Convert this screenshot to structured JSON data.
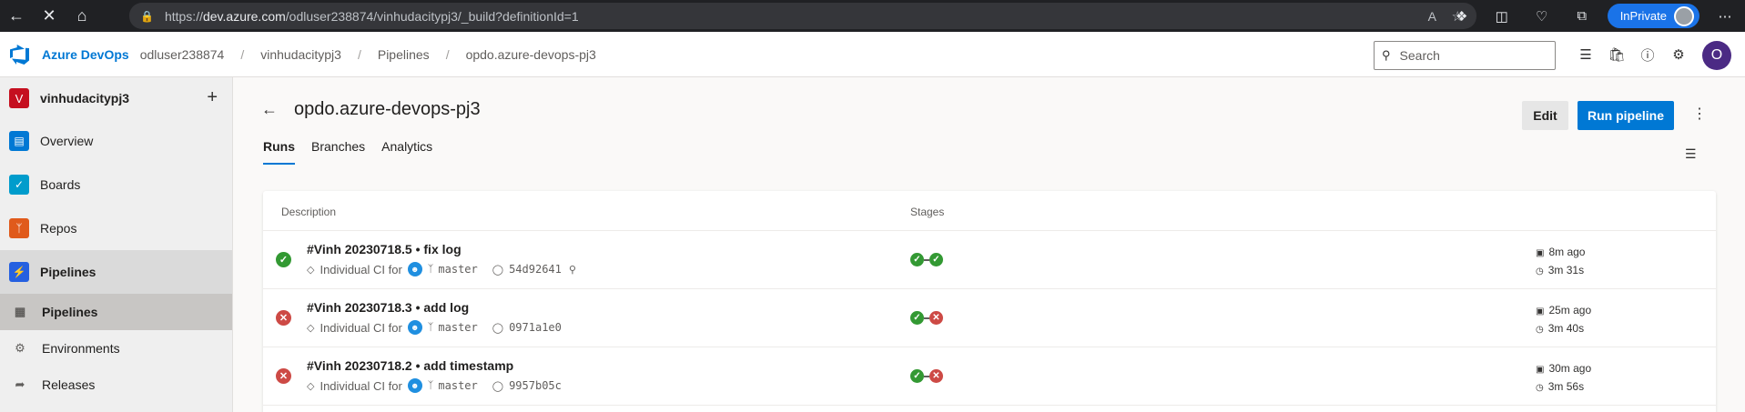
{
  "browser": {
    "url_prefix": "https://",
    "url_host": "dev.azure.com",
    "url_path": "/odluser238874/vinhudacitypj3/_build?definitionId=1",
    "inprivate_label": "InPrivate",
    "read_aloud_label": "A"
  },
  "header": {
    "brand": "Azure DevOps",
    "breadcrumbs": [
      "odluser238874",
      "vinhudacitypj3",
      "Pipelines",
      "opdo.azure-devops-pj3"
    ],
    "separator": "/",
    "search_placeholder": "Search",
    "user_initial": "O"
  },
  "sidebar": {
    "project_initial": "V",
    "project_name": "vinhudacitypj3",
    "add_label": "+",
    "items": [
      {
        "label": "Overview",
        "icon": "overview-icon",
        "color": "#0078d4"
      },
      {
        "label": "Boards",
        "icon": "boards-icon",
        "color": "#009ccc"
      },
      {
        "label": "Repos",
        "icon": "repos-icon",
        "color": "#e05a1b"
      },
      {
        "label": "Pipelines",
        "icon": "pipelines-icon",
        "color": "#2560e0"
      }
    ],
    "sub_items": [
      {
        "label": "Pipelines",
        "icon": "pipelines-sub-icon"
      },
      {
        "label": "Environments",
        "icon": "environments-icon"
      },
      {
        "label": "Releases",
        "icon": "releases-icon"
      }
    ]
  },
  "main": {
    "title": "opdo.azure-devops-pj3",
    "edit_label": "Edit",
    "run_label": "Run pipeline",
    "tabs": [
      "Runs",
      "Branches",
      "Analytics"
    ],
    "columns": {
      "description": "Description",
      "stages": "Stages"
    },
    "runs": [
      {
        "title": "#Vinh 20230718.5 • fix log",
        "status": "succeeded",
        "trigger": "Individual CI for",
        "branch": "master",
        "commit": "54d92641",
        "stages": [
          "succeeded",
          "succeeded"
        ],
        "ago": "8m ago",
        "duration": "3m 31s"
      },
      {
        "title": "#Vinh 20230718.3 • add log",
        "status": "failed",
        "trigger": "Individual CI for",
        "branch": "master",
        "commit": "0971a1e0",
        "stages": [
          "succeeded",
          "failed"
        ],
        "ago": "25m ago",
        "duration": "3m 40s"
      },
      {
        "title": "#Vinh 20230718.2 • add timestamp",
        "status": "failed",
        "trigger": "Individual CI for",
        "branch": "master",
        "commit": "9957b05c",
        "stages": [
          "succeeded",
          "failed"
        ],
        "ago": "30m ago",
        "duration": "3m 56s"
      }
    ]
  }
}
